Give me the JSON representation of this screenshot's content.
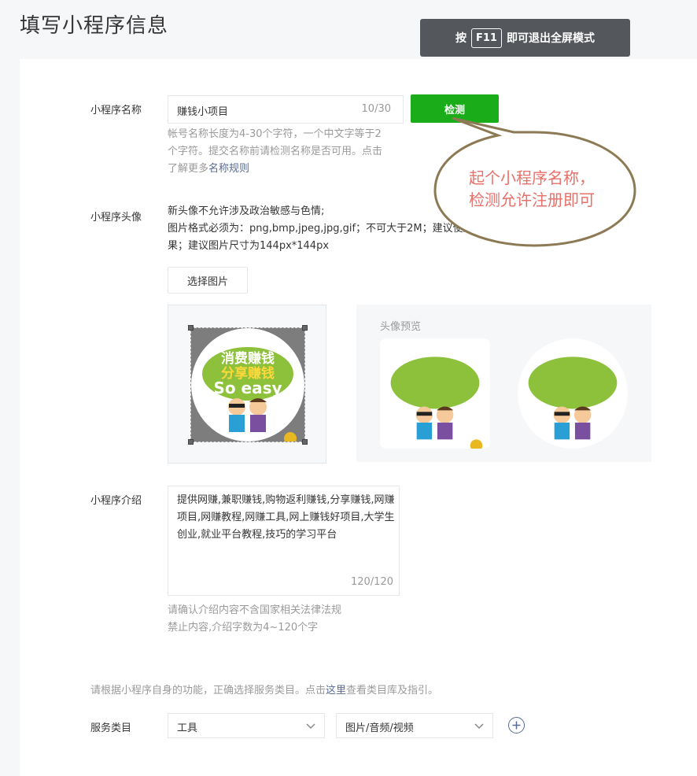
{
  "page": {
    "title": "填写小程序信息"
  },
  "fullscreen_tip": {
    "prefix": "按",
    "key": "F11",
    "suffix": "即可退出全屏模式"
  },
  "name_field": {
    "label": "小程序名称",
    "value": "赚钱小项目",
    "count": "10/30",
    "check_button": "检测",
    "hint_line1": "帐号名称长度为4-30个字符，一个中文字等于2",
    "hint_line2": "个字符。提交名称前请检测名称是否可用。点击",
    "hint_line3_prefix": "了解更多",
    "hint_link": "名称规则"
  },
  "bubble": {
    "line1": "起个小程序名称，",
    "line2": "检测允许注册即可"
  },
  "avatar": {
    "label": "小程序头像",
    "desc_line1": "新头像不允许涉及政治敏感与色情;",
    "desc_line2": "图片格式必须为：png,bmp,jpeg,jpg,gif；不可大于2M；建议使用png格式图片，以保持最佳效",
    "desc_line3": "果；建议图片尺寸为144px*144px",
    "choose_button": "选择图片",
    "preview_title": "头像预览",
    "image_text_line1": "消费赚钱",
    "image_text_line2": "分享赚钱",
    "image_text_line3": "So easy"
  },
  "intro": {
    "label": "小程序介绍",
    "value": "提供网赚,兼职赚钱,购物返利赚钱,分享赚钱,网赚项目,网赚教程,网赚工具,网上赚钱好项目,大学生创业,就业平台教程,技巧的学习平台",
    "count": "120/120",
    "hint_line1": "请确认介绍内容不含国家相关法律法规",
    "hint_line2": "禁止内容,介绍字数为4~120个字"
  },
  "category": {
    "hint_prefix": "请根据小程序自身的功能，正确选择服务类目。点击",
    "hint_link": "这里",
    "hint_suffix": "查看类目库及指引。",
    "label": "服务类目",
    "primary": "工具",
    "secondary": "图片/音频/视频"
  },
  "colors": {
    "green": "#1aad19",
    "link": "#576b95",
    "bubble_text": "#e8706a"
  },
  "icons": [
    "chevron-down-icon",
    "plus-circle-icon"
  ]
}
